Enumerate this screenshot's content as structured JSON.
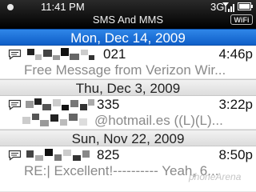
{
  "status_bar": {
    "time": "11:41 PM",
    "network": "3G",
    "title": "SMS And MMS",
    "wifi_label": "WiFi"
  },
  "groups": [
    {
      "date": "Mon, Dec 14, 2009",
      "selected": true,
      "message": {
        "contact_suffix": "021",
        "time": "4:46p",
        "preview": "Free Message from Verizon Wir..."
      }
    },
    {
      "date": "Thu, Dec 3, 2009",
      "selected": false,
      "message": {
        "contact_suffix": "335",
        "time": "3:22p",
        "preview": "@hotmail.es ((L)(L)..."
      }
    },
    {
      "date": "Sun, Nov 22, 2009",
      "selected": false,
      "message": {
        "contact_suffix": "825",
        "time": "8:50p",
        "preview": "RE:| Excellent!---------- Yeah, 6..."
      }
    }
  ],
  "watermark": "phoneArena",
  "colors": {
    "selection": "#1a6fd8",
    "header_gray": "#e4e4e4",
    "preview_gray": "#8a8a8a"
  }
}
